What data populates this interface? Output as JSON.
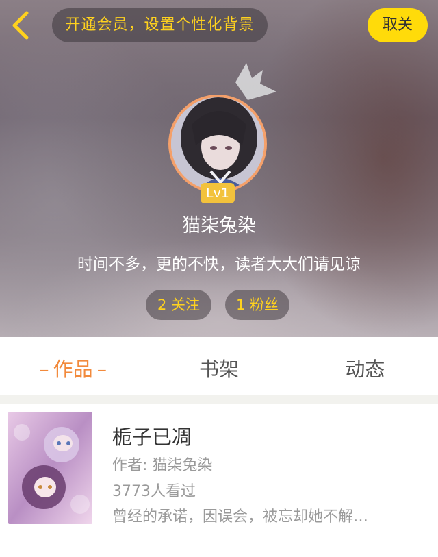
{
  "header": {
    "vip_banner": "开通会员，设置个性化背景",
    "unfollow_label": "取关",
    "level_badge": "Lv1",
    "username": "猫柒兔染",
    "bio": "时间不多，更的不快，读者大大们请见谅",
    "following": "2 关注",
    "fans": "1 粉丝"
  },
  "tabs": [
    {
      "label": "作品",
      "active": true
    },
    {
      "label": "书架",
      "active": false
    },
    {
      "label": "动态",
      "active": false
    }
  ],
  "tab_dash": "–",
  "book": {
    "title": "栀子已凋",
    "author": "作者: 猫柒兔染",
    "views": "3773人看过",
    "description": "曾经的承诺，因误会，被忘却她不解…"
  },
  "colors": {
    "accent": "#f28a3c",
    "vip_yellow": "#ffd21e",
    "button_yellow": "#ffdb0a",
    "avatar_ring": "#f4a06a",
    "badge": "#f2c23c"
  },
  "icons": {
    "back": "chevron-left-icon",
    "crown": "crown-icon"
  }
}
